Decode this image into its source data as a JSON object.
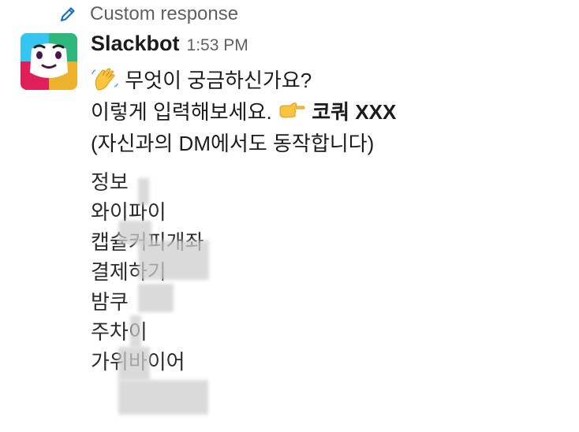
{
  "header": {
    "custom_response_label": "Custom response"
  },
  "message": {
    "sender": "Slackbot",
    "timestamp": "1:53 PM",
    "line1": "무엇이 궁금하신가요?",
    "line2_text": "이렇게 입력해보세요.",
    "line2_command": "코쿼 XXX",
    "line3": "(자신과의 DM에서도 동작합니다)"
  },
  "commands": [
    "정보",
    "와이파이",
    "캡슐커피개좌",
    "결제하기",
    "밤쿠",
    "주차이",
    "가위바이어"
  ],
  "icons": {
    "pencil": "pencil-icon",
    "avatar": "slackbot-avatar",
    "wave": "waving-hand-emoji",
    "point": "pointing-right-emoji"
  },
  "colors": {
    "pencil": "#1d6fb8",
    "muted_text": "#616061",
    "text": "#1d1c1d"
  }
}
